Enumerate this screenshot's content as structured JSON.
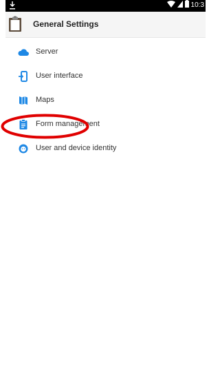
{
  "status_bar": {
    "time": "10:3"
  },
  "app_bar": {
    "title": "General Settings",
    "icon": "clipboard-icon"
  },
  "menu": {
    "items": [
      {
        "label": "Server",
        "icon": "cloud-icon"
      },
      {
        "label": "User interface",
        "icon": "user-interface-icon"
      },
      {
        "label": "Maps",
        "icon": "map-icon"
      },
      {
        "label": "Form management",
        "icon": "form-management-icon"
      },
      {
        "label": "User and device identity",
        "icon": "identity-icon"
      }
    ]
  },
  "colors": {
    "accent": "#1e88e5",
    "highlight_ring": "#e00000",
    "status_bar": "#000000",
    "app_bar": "#f5f5f5"
  }
}
